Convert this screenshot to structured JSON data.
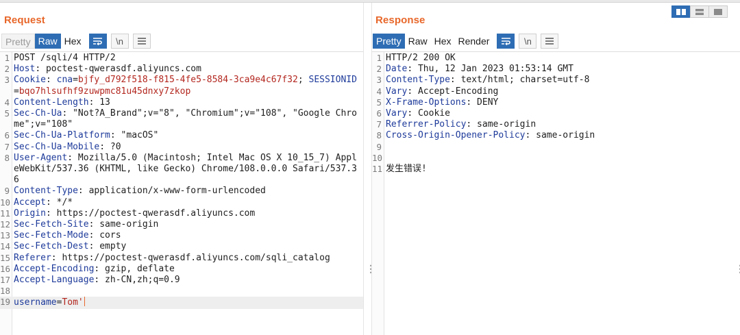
{
  "request": {
    "title": "Request",
    "tabs": [
      {
        "label": "Pretty",
        "state": "dim"
      },
      {
        "label": "Raw",
        "state": "active"
      },
      {
        "label": "Hex",
        "state": "normal"
      }
    ],
    "icons": [
      "wrap-icon",
      "newline-icon",
      "menu-icon"
    ],
    "newline_label": "\\n",
    "lines": [
      {
        "n": "1",
        "k": "",
        "v": "POST /sqli/4 HTTP/2"
      },
      {
        "n": "2",
        "k": "Host",
        "v": " poctest-qwerasdf.aliyuncs.com"
      },
      {
        "n": "3",
        "k": "Cookie",
        "cookie": [
          {
            "k": "cna",
            "v": "bjfy_d792f518-f815-4fe5-8584-3ca9e4c67f32"
          },
          {
            "k": "SESSIONID",
            "v": "bqo7hlsufhf9zuwpmc81u45dnxy7zkop"
          }
        ]
      },
      {
        "n": "4",
        "k": "Content-Length",
        "v": " 13"
      },
      {
        "n": "5",
        "k": "Sec-Ch-Ua",
        "v": " \"Not?A_Brand\";v=\"8\", \"Chromium\";v=\"108\", \"Google Chrome\";v=\"108\""
      },
      {
        "n": "6",
        "k": "Sec-Ch-Ua-Platform",
        "v": " \"macOS\""
      },
      {
        "n": "7",
        "k": "Sec-Ch-Ua-Mobile",
        "v": " ?0"
      },
      {
        "n": "8",
        "k": "User-Agent",
        "v": " Mozilla/5.0 (Macintosh; Intel Mac OS X 10_15_7) AppleWebKit/537.36 (KHTML, like Gecko) Chrome/108.0.0.0 Safari/537.36"
      },
      {
        "n": "9",
        "k": "Content-Type",
        "v": " application/x-www-form-urlencoded"
      },
      {
        "n": "10",
        "k": "Accept",
        "v": " */*"
      },
      {
        "n": "11",
        "k": "Origin",
        "v": " https://poctest-qwerasdf.aliyuncs.com"
      },
      {
        "n": "12",
        "k": "Sec-Fetch-Site",
        "v": " same-origin"
      },
      {
        "n": "13",
        "k": "Sec-Fetch-Mode",
        "v": " cors"
      },
      {
        "n": "14",
        "k": "Sec-Fetch-Dest",
        "v": " empty"
      },
      {
        "n": "15",
        "k": "Referer",
        "v": " https://poctest-qwerasdf.aliyuncs.com/sqli_catalog"
      },
      {
        "n": "16",
        "k": "Accept-Encoding",
        "v": " gzip, deflate"
      },
      {
        "n": "17",
        "k": "Accept-Language",
        "v": " zh-CN,zh;q=0.9"
      },
      {
        "n": "18",
        "k": "",
        "v": ""
      },
      {
        "n": "19",
        "body": {
          "k": "username",
          "v": "Tom'"
        }
      }
    ]
  },
  "response": {
    "title": "Response",
    "tabs": [
      {
        "label": "Pretty",
        "state": "active"
      },
      {
        "label": "Raw",
        "state": "normal"
      },
      {
        "label": "Hex",
        "state": "normal"
      },
      {
        "label": "Render",
        "state": "normal"
      }
    ],
    "icons": [
      "wrap-icon",
      "newline-icon",
      "menu-icon"
    ],
    "newline_label": "\\n",
    "lines": [
      {
        "n": "1",
        "k": "",
        "v": "HTTP/2 200 OK"
      },
      {
        "n": "2",
        "k": "Date",
        "v": " Thu, 12 Jan 2023 01:53:14 GMT"
      },
      {
        "n": "3",
        "k": "Content-Type",
        "v": " text/html; charset=utf-8"
      },
      {
        "n": "4",
        "k": "Vary",
        "v": " Accept-Encoding"
      },
      {
        "n": "5",
        "k": "X-Frame-Options",
        "v": " DENY"
      },
      {
        "n": "6",
        "k": "Vary",
        "v": " Cookie"
      },
      {
        "n": "7",
        "k": "Referrer-Policy",
        "v": " same-origin"
      },
      {
        "n": "8",
        "k": "Cross-Origin-Opener-Policy",
        "v": " same-origin"
      },
      {
        "n": "9",
        "k": "",
        "v": ""
      },
      {
        "n": "10",
        "k": "",
        "v": ""
      },
      {
        "n": "11",
        "k": "",
        "v": "发生错误!"
      }
    ]
  },
  "layout_toggle": [
    {
      "name": "side-by-side-icon",
      "state": "active"
    },
    {
      "name": "stacked-icon",
      "state": "normal"
    },
    {
      "name": "single-pane-icon",
      "state": "normal"
    }
  ],
  "colors": {
    "title": "#e8672a",
    "active": "#2e6db4",
    "header_key": "#1d3a9a",
    "cookie_value": "#b3261e",
    "caret": "#e8672a"
  }
}
